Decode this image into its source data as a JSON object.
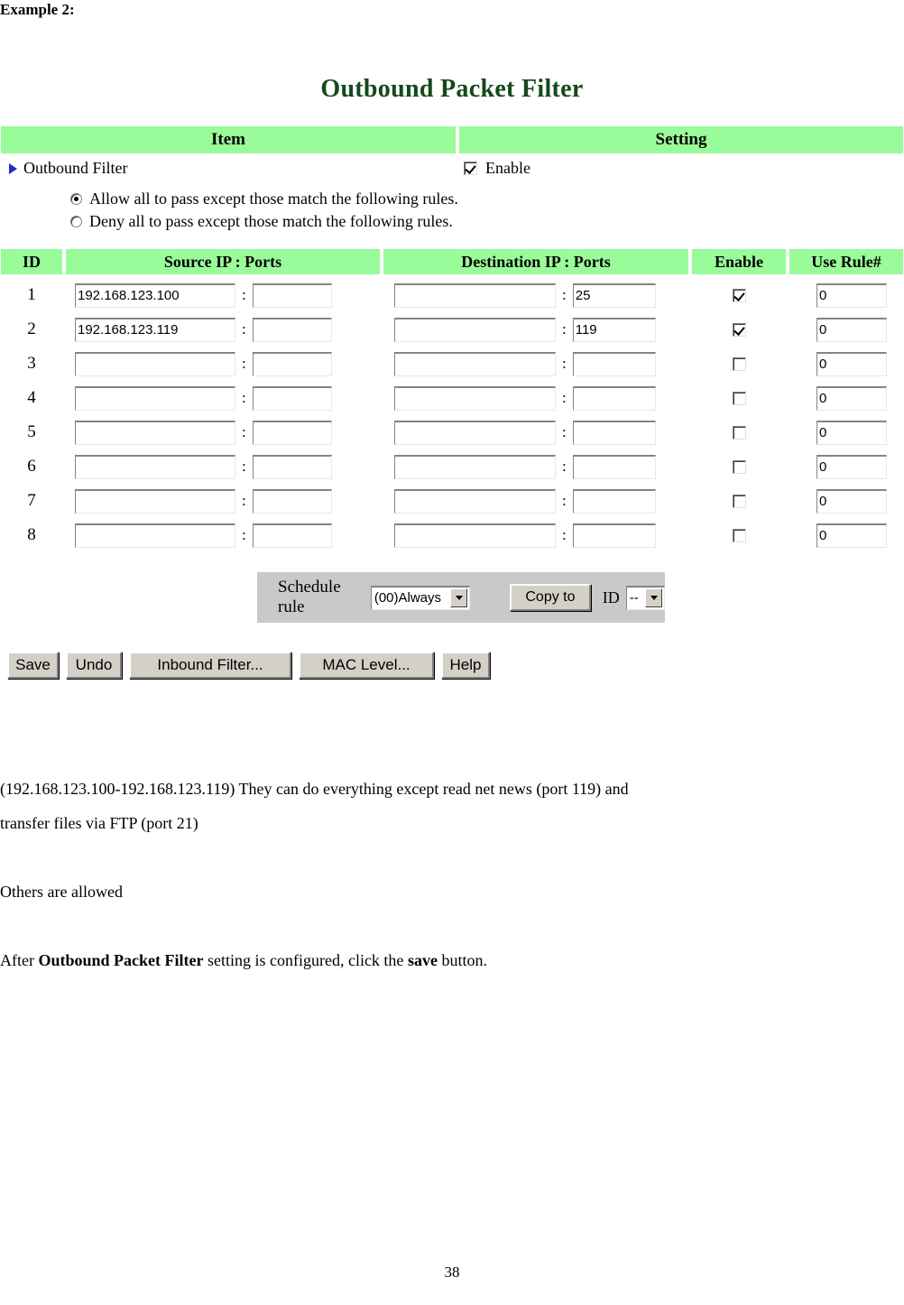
{
  "document": {
    "example_heading": "Example 2:",
    "page_number": "38"
  },
  "ui": {
    "title": "Outbound Packet Filter",
    "header_bar": {
      "item": "Item",
      "setting": "Setting"
    },
    "outbound_filter": {
      "label": "Outbound Filter",
      "enable_label": "Enable",
      "enable_checked": true,
      "policy_options": [
        {
          "label": "Allow all to pass except those match the following rules.",
          "selected": true
        },
        {
          "label": "Deny all to pass except those match the following rules.",
          "selected": false
        }
      ]
    },
    "rules_table": {
      "columns": [
        "ID",
        "Source IP : Ports",
        "Destination IP : Ports",
        "Enable",
        "Use Rule#"
      ],
      "separator": ":",
      "rows": [
        {
          "id": "1",
          "source_ip": "192.168.123.100",
          "source_port": "",
          "dest_ip": "",
          "dest_port": "25",
          "enable": true,
          "use_rule": "0"
        },
        {
          "id": "2",
          "source_ip": "192.168.123.119",
          "source_port": "",
          "dest_ip": "",
          "dest_port": "119",
          "enable": true,
          "use_rule": "0"
        },
        {
          "id": "3",
          "source_ip": "",
          "source_port": "",
          "dest_ip": "",
          "dest_port": "",
          "enable": false,
          "use_rule": "0"
        },
        {
          "id": "4",
          "source_ip": "",
          "source_port": "",
          "dest_ip": "",
          "dest_port": "",
          "enable": false,
          "use_rule": "0"
        },
        {
          "id": "5",
          "source_ip": "",
          "source_port": "",
          "dest_ip": "",
          "dest_port": "",
          "enable": false,
          "use_rule": "0"
        },
        {
          "id": "6",
          "source_ip": "",
          "source_port": "",
          "dest_ip": "",
          "dest_port": "",
          "enable": false,
          "use_rule": "0"
        },
        {
          "id": "7",
          "source_ip": "",
          "source_port": "",
          "dest_ip": "",
          "dest_port": "",
          "enable": false,
          "use_rule": "0"
        },
        {
          "id": "8",
          "source_ip": "",
          "source_port": "",
          "dest_ip": "",
          "dest_port": "",
          "enable": false,
          "use_rule": "0"
        }
      ]
    },
    "schedule_bar": {
      "label": "Schedule rule",
      "schedule_value": "(00)Always",
      "copy_to_label": "Copy to",
      "id_label": "ID",
      "id_value": "--"
    },
    "actions": {
      "save": "Save",
      "undo": "Undo",
      "inbound_filter": "Inbound Filter...",
      "mac_level": "MAC Level...",
      "help": "Help"
    },
    "colors": {
      "header_green": "#99FB99",
      "title_green": "#14491A",
      "bullet_blue": "#2727D0",
      "panel_gray": "#C9C9C9",
      "button_face": "#D4D0C8"
    }
  },
  "prose": {
    "line1": "(192.168.123.100-192.168.123.119) They can do everything except read net news (port 119) and",
    "line2": "transfer files via FTP (port 21)",
    "line3": "Others are allowed",
    "line4_prefix": "After ",
    "line4_bold1": "Outbound Packet Filter",
    "line4_mid": " setting is configured, click the ",
    "line4_bold2": "save",
    "line4_suffix": " button."
  }
}
